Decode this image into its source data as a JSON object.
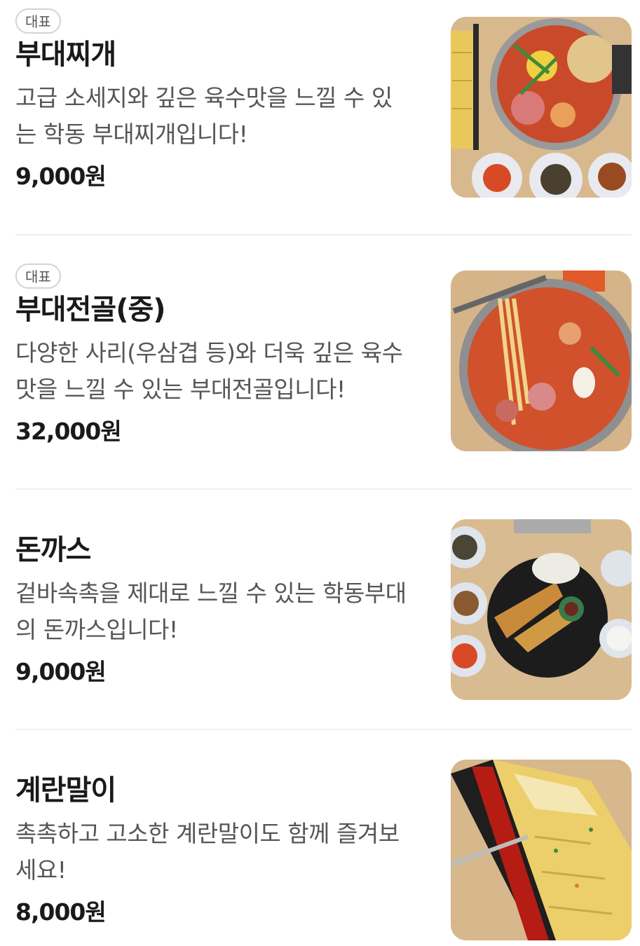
{
  "menu": {
    "items": [
      {
        "badge": "대표",
        "name": "부대찌개",
        "description": "고급 소세지와 깊은 육수맛을 느낄 수 있는 학동 부대찌개입니다!",
        "price": "9,000원",
        "image_icon": "budae-jjigae-photo"
      },
      {
        "badge": "대표",
        "name": "부대전골(중)",
        "description": "다양한 사리(우삼겹 등)와 더욱 깊은 육수 맛을 느낄 수 있는 부대전골입니다!",
        "price": "32,000원",
        "image_icon": "budae-jeongol-photo"
      },
      {
        "name": "돈까스",
        "description": "겉바속촉을 제대로 느낄 수 있는 학동부대의 돈까스입니다!",
        "price": "9,000원",
        "image_icon": "pork-cutlet-photo"
      },
      {
        "name": "계란말이",
        "description": "촉촉하고 고소한 계란말이도 함께 즐겨보세요!",
        "price": "8,000원",
        "image_icon": "rolled-omelette-photo"
      }
    ]
  }
}
